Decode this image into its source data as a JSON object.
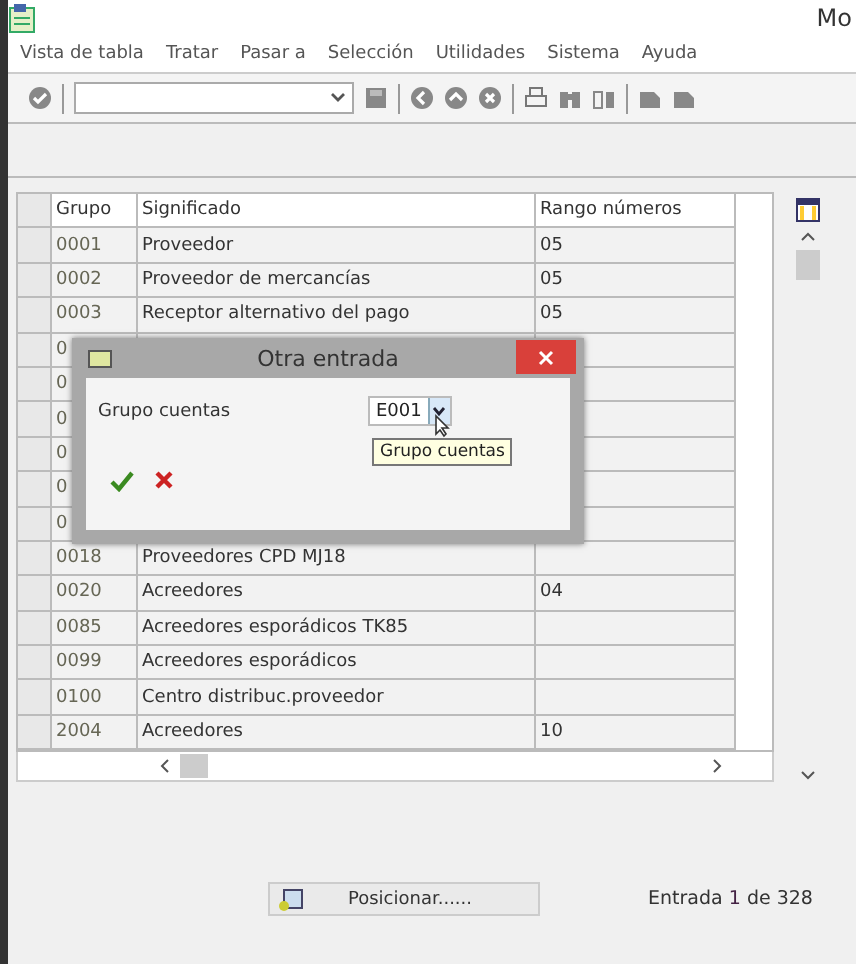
{
  "window": {
    "title": "Mo"
  },
  "menu": [
    "Vista de tabla",
    "Tratar",
    "Pasar a",
    "Selección",
    "Utilidades",
    "Sistema",
    "Ayuda"
  ],
  "table": {
    "columns": [
      "Grupo",
      "Significado",
      "Rango números"
    ],
    "rows": [
      {
        "grupo": "0001",
        "significado": "Proveedor",
        "rango": "05"
      },
      {
        "grupo": "0002",
        "significado": "Proveedor de mercancías",
        "rango": "05"
      },
      {
        "grupo": "0003",
        "significado": "Receptor alternativo del pago",
        "rango": "05"
      },
      {
        "grupo": "0",
        "significado": "",
        "rango": ""
      },
      {
        "grupo": "0",
        "significado": "",
        "rango": ""
      },
      {
        "grupo": "0",
        "significado": "",
        "rango": ""
      },
      {
        "grupo": "0",
        "significado": "",
        "rango": ""
      },
      {
        "grupo": "0",
        "significado": "",
        "rango": ""
      },
      {
        "grupo": "0",
        "significado": "",
        "rango": ""
      },
      {
        "grupo": "0018",
        "significado": "Proveedores CPD MJ18",
        "rango": ""
      },
      {
        "grupo": "0020",
        "significado": "Acreedores",
        "rango": "04"
      },
      {
        "grupo": "0085",
        "significado": "Acreedores esporádicos TK85",
        "rango": ""
      },
      {
        "grupo": "0099",
        "significado": "Acreedores esporádicos",
        "rango": ""
      },
      {
        "grupo": "0100",
        "significado": "Centro distribuc.proveedor",
        "rango": ""
      },
      {
        "grupo": "2004",
        "significado": "Acreedores",
        "rango": "10"
      }
    ]
  },
  "dialog": {
    "title": "Otra entrada",
    "field_label": "Grupo cuentas",
    "field_value": "E001",
    "tooltip": "Grupo cuentas"
  },
  "position_button": "Posicionar......",
  "entry_count": {
    "prefix": "Entrada",
    "current": "1",
    "middle": "de",
    "total": "328"
  }
}
